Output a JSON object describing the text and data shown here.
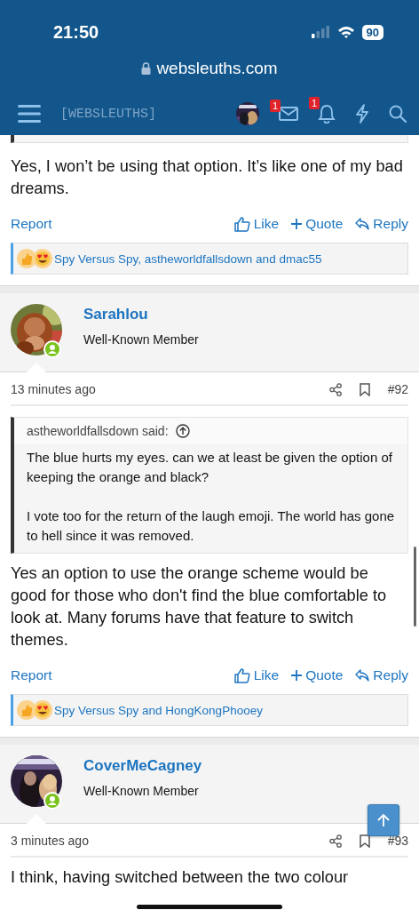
{
  "status_bar": {
    "time": "21:50",
    "battery": "90"
  },
  "address_bar": {
    "url": "websleuths.com"
  },
  "nav": {
    "logo": "[WEBSLEUTHS]",
    "badges": [
      {
        "kind": "mail",
        "count": "1"
      },
      {
        "kind": "bell",
        "count": "1"
      }
    ]
  },
  "posts": [
    {
      "kind": "partial",
      "body": [
        "Yes, I won’t be using that option. It’s like one of my bad dreams."
      ],
      "actions": {
        "report": "Report",
        "like": "Like",
        "quote": "Quote",
        "reply": "Reply"
      },
      "reactions": "Spy Versus Spy, astheworldfallsdown and dmac55"
    },
    {
      "kind": "full",
      "user": {
        "name": "Sarahlou",
        "role": "Well-Known Member",
        "online": true
      },
      "time": "13 minutes ago",
      "number": "#92",
      "quote": {
        "author": "astheworldfallsdown said:",
        "paragraphs": [
          "The blue hurts my eyes. can we at least be given the option of keeping the orange and black?",
          "I vote too for the return of the laugh emoji. The world has gone to hell since it was removed."
        ]
      },
      "body": [
        "Yes an option to use the orange scheme would be good for those who don't find the blue comfortable to look at. Many forums have that feature to switch themes."
      ],
      "actions": {
        "report": "Report",
        "like": "Like",
        "quote": "Quote",
        "reply": "Reply"
      },
      "reactions": "Spy Versus Spy and HongKongPhooey"
    },
    {
      "kind": "full",
      "user": {
        "name": "CoverMeCagney",
        "role": "Well-Known Member",
        "online": true
      },
      "time": "3 minutes ago",
      "number": "#93",
      "body": [
        "I think, having switched between the two colour"
      ]
    }
  ]
}
